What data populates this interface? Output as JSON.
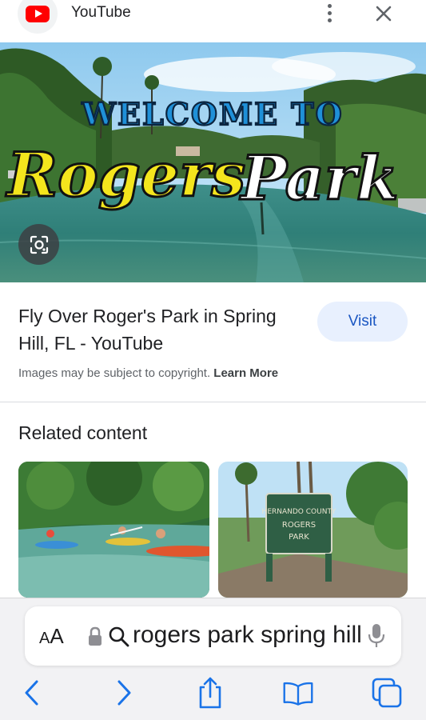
{
  "header": {
    "source_name": "YouTube",
    "icons": {
      "logo": "youtube-logo-icon",
      "more": "more-vert-icon",
      "close": "close-icon"
    }
  },
  "hero": {
    "overlay_line1": "WELCOME TO",
    "overlay_line2a": "Rogers",
    "overlay_line2b": "Park",
    "lens_icon": "lens-icon"
  },
  "result": {
    "title": "Fly Over Roger's Park in Spring Hill, FL - YouTube",
    "visit_label": "Visit",
    "copyright_text": "Images may be subject to copyright.",
    "learn_more_label": "Learn More"
  },
  "related": {
    "heading": "Related content",
    "thumbnails": [
      {
        "sign_line1": "",
        "sign_line2": "",
        "sign_line3": ""
      },
      {
        "sign_line1": "HERNANDO COUNTY",
        "sign_line2": "ROGERS",
        "sign_line3": "PARK"
      }
    ]
  },
  "safari": {
    "aa_label_large": "A",
    "aa_label_small": "A",
    "address_text": "rogers park spring hill",
    "toolbar_icons": [
      "back-icon",
      "forward-icon",
      "share-icon",
      "bookmarks-icon",
      "tabs-icon"
    ]
  },
  "colors": {
    "accent_blue": "#1a56c2",
    "visit_bg": "#e8f0fe",
    "youtube_red": "#ff0000",
    "ios_blue": "#1a73e8"
  }
}
